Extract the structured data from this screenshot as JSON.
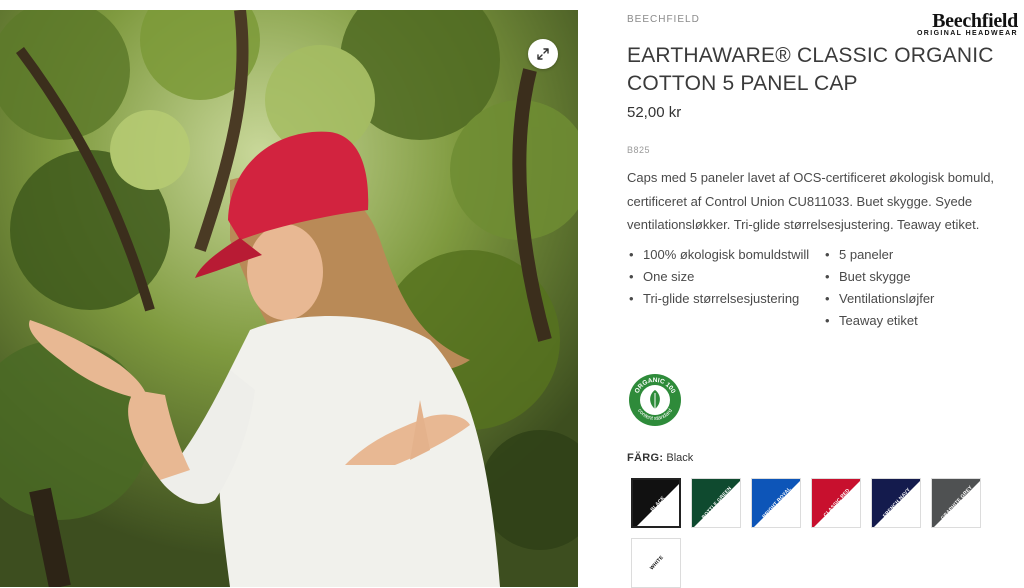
{
  "product": {
    "brand_label": "BEECHFIELD",
    "brand_logo_text": "Beechfield",
    "brand_logo_tagline": "ORIGINAL HEADWEAR",
    "title": "EARTHAWARE® CLASSIC ORGANIC COTTON 5 PANEL CAP",
    "price": "52,00 kr",
    "sku": "B825",
    "description": "Caps med 5 paneler lavet af OCS-certificeret økologisk bomuld, certificeret af Control Union CU811033. Buet skygge. Syede ventilationsløkker. Tri-glide størrelsesjustering. Teaway etiket.",
    "features_col1": [
      "100% økologisk bomuldstwill",
      "One size",
      "Tri-glide størrelsesjustering"
    ],
    "features_col2": [
      "5 paneler",
      "Buet skygge",
      "Ventilationsløjfer",
      "Teaway etiket"
    ]
  },
  "certification": {
    "icon": "organic-100-content-standard-badge",
    "top_text": "ORGANIC 100",
    "bottom_text": "content standard",
    "color": "#2e8b3a"
  },
  "color_picker": {
    "label": "FÄRG:",
    "selected": "Black",
    "swatches": [
      {
        "name": "BLACK",
        "hex": "#111111",
        "text_color": "#ffffff"
      },
      {
        "name": "BOTTLE GREEN",
        "hex": "#0f4a2f",
        "text_color": "#ffffff"
      },
      {
        "name": "BRIGHT ROYAL",
        "hex": "#0d55b8",
        "text_color": "#ffffff"
      },
      {
        "name": "CLASSIC RED",
        "hex": "#c8102e",
        "text_color": "#ffffff"
      },
      {
        "name": "FRENCH NAVY",
        "hex": "#141b4d",
        "text_color": "#ffffff"
      },
      {
        "name": "GRAPHITE GREY",
        "hex": "#4f5152",
        "text_color": "#ffffff"
      },
      {
        "name": "WHITE",
        "hex": "#ffffff",
        "text_color": "#111111"
      }
    ]
  },
  "image": {
    "zoom_icon": "expand-arrows-icon"
  }
}
